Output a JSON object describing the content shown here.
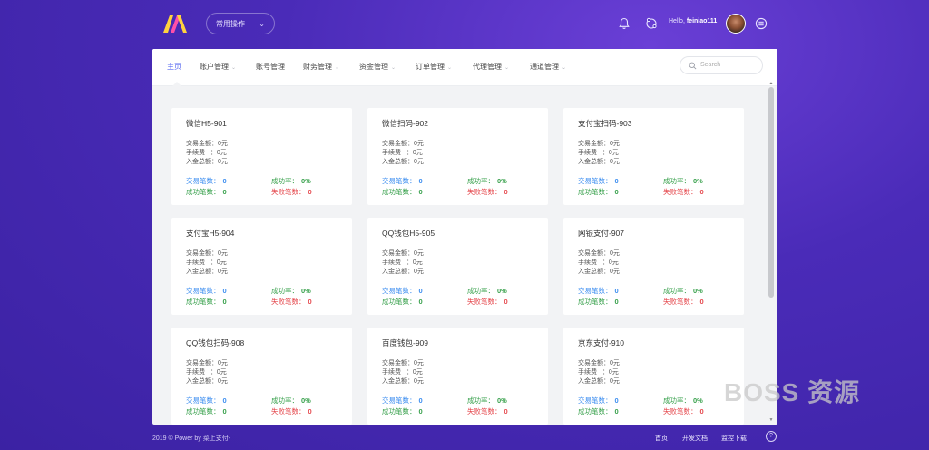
{
  "header": {
    "quick_select": {
      "label": "常用操作"
    },
    "greeting": "Hello, ",
    "username": "feiniao111"
  },
  "nav": {
    "items": [
      {
        "label": "主页",
        "active": true,
        "caret": false
      },
      {
        "label": "账户管理",
        "active": false,
        "caret": true
      },
      {
        "label": "账号管理",
        "active": false,
        "caret": false
      },
      {
        "label": "财务管理",
        "active": false,
        "caret": true
      },
      {
        "label": "资金管理",
        "active": false,
        "caret": true
      },
      {
        "label": "订单管理",
        "active": false,
        "caret": true
      },
      {
        "label": "代理管理",
        "active": false,
        "caret": true
      },
      {
        "label": "通道管理",
        "active": false,
        "caret": true
      }
    ],
    "search_placeholder": "Search"
  },
  "card_labels": {
    "amount": "交易金额",
    "fee": "手续费",
    "entry": "入金总额",
    "trade_count": "交易笔数",
    "success_rate": "成功率",
    "success_count": "成功笔数",
    "fail_count": "失败笔数"
  },
  "cards": [
    {
      "title": "微信H5-901",
      "amount": "0元",
      "fee": "0元",
      "entry": "0元",
      "trade_count": "0",
      "success_rate": "0%",
      "success_count": "0",
      "fail_count": "0"
    },
    {
      "title": "微信扫码-902",
      "amount": "0元",
      "fee": "0元",
      "entry": "0元",
      "trade_count": "0",
      "success_rate": "0%",
      "success_count": "0",
      "fail_count": "0"
    },
    {
      "title": "支付宝扫码-903",
      "amount": "0元",
      "fee": "0元",
      "entry": "0元",
      "trade_count": "0",
      "success_rate": "0%",
      "success_count": "0",
      "fail_count": "0"
    },
    {
      "title": "支付宝H5-904",
      "amount": "0元",
      "fee": "0元",
      "entry": "0元",
      "trade_count": "0",
      "success_rate": "0%",
      "success_count": "0",
      "fail_count": "0"
    },
    {
      "title": "QQ钱包H5-905",
      "amount": "0元",
      "fee": "0元",
      "entry": "0元",
      "trade_count": "0",
      "success_rate": "0%",
      "success_count": "0",
      "fail_count": "0"
    },
    {
      "title": "网银支付-907",
      "amount": "0元",
      "fee": "0元",
      "entry": "0元",
      "trade_count": "0",
      "success_rate": "0%",
      "success_count": "0",
      "fail_count": "0"
    },
    {
      "title": "QQ钱包扫码-908",
      "amount": "0元",
      "fee": "0元",
      "entry": "0元",
      "trade_count": "0",
      "success_rate": "0%",
      "success_count": "0",
      "fail_count": "0"
    },
    {
      "title": "百度钱包-909",
      "amount": "0元",
      "fee": "0元",
      "entry": "0元",
      "trade_count": "0",
      "success_rate": "0%",
      "success_count": "0",
      "fail_count": "0"
    },
    {
      "title": "京东支付-910",
      "amount": "0元",
      "fee": "0元",
      "entry": "0元",
      "trade_count": "0",
      "success_rate": "0%",
      "success_count": "0",
      "fail_count": "0"
    }
  ],
  "footer": {
    "copyright": "2019 © Power by 菜上支付-",
    "links": [
      "首页",
      "开发文档",
      "监控下载"
    ],
    "help": "?"
  },
  "watermark": "BOSS 资源"
}
